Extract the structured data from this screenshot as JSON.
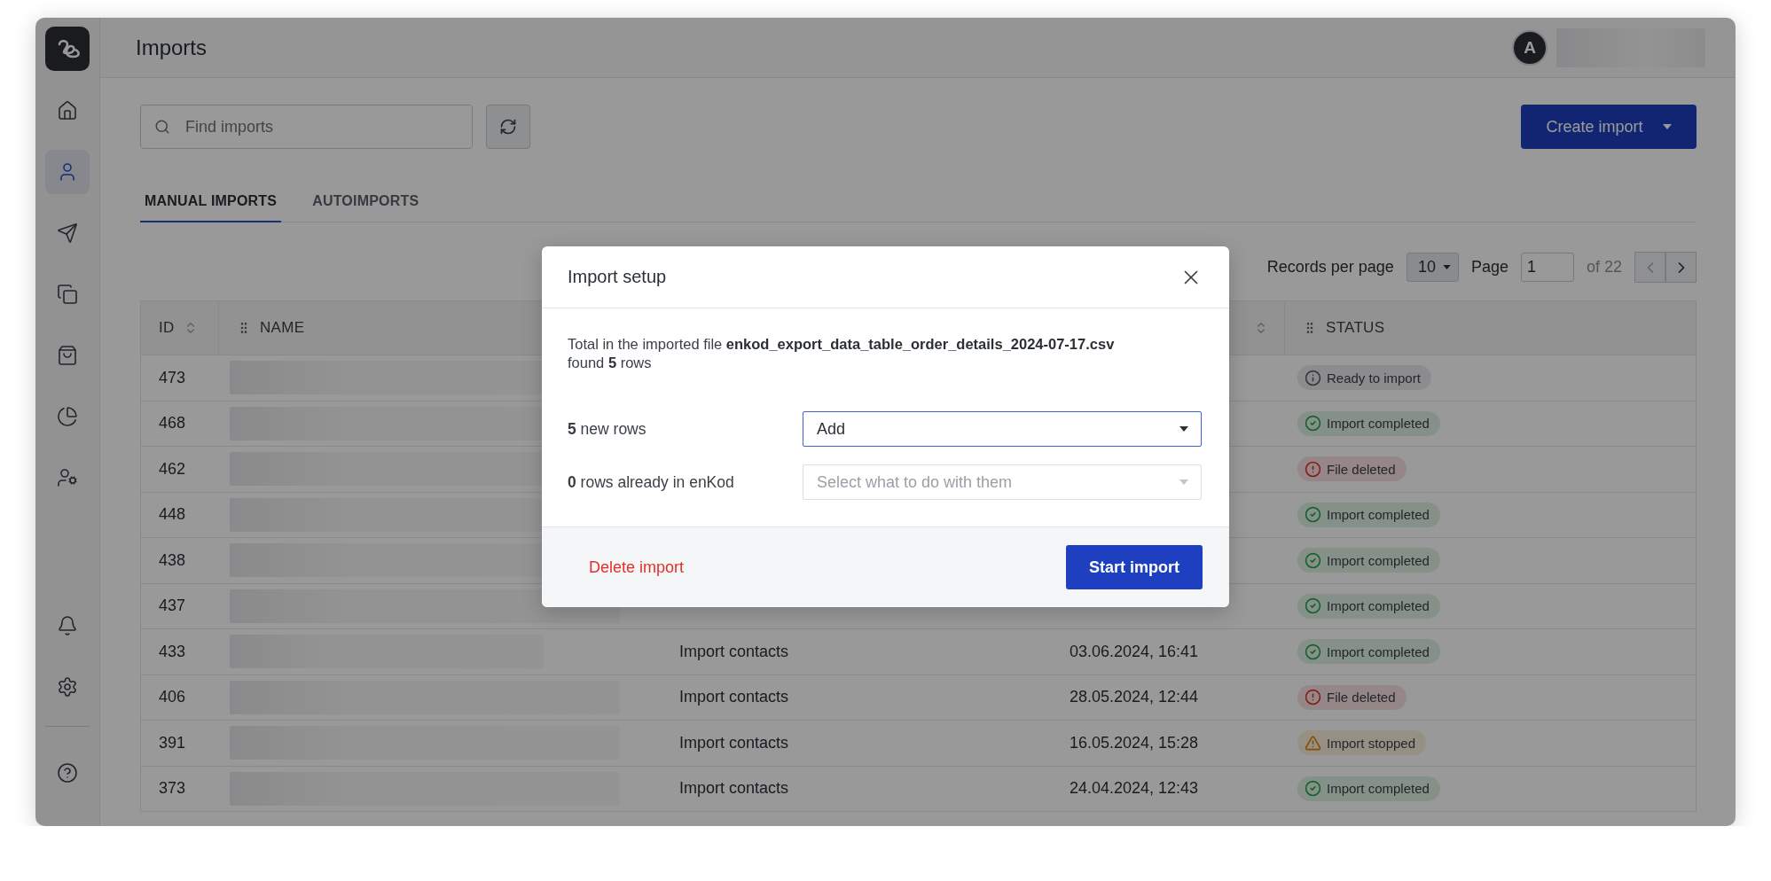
{
  "header": {
    "title": "Imports",
    "avatar": "A"
  },
  "sidebar": {
    "top_items": [
      {
        "selected": false
      },
      {
        "selected": true
      },
      {
        "selected": false
      },
      {
        "selected": false
      },
      {
        "selected": false
      },
      {
        "selected": false
      },
      {
        "selected": false
      }
    ],
    "bottom_items": [
      {
        "selected": false
      },
      {
        "selected": false
      },
      {
        "selected": false
      }
    ]
  },
  "toolbar": {
    "search": {
      "placeholder": "Find imports"
    },
    "create_button": "Create import"
  },
  "tabs": [
    {
      "label": "MANUAL IMPORTS",
      "selected": true
    },
    {
      "label": "AUTOIMPORTS",
      "selected": false
    }
  ],
  "pagination": {
    "records_label": "Records per page",
    "per_page": "10",
    "page_label": "Page",
    "page": "1",
    "total": "of 22",
    "prev_disabled": true
  },
  "table": {
    "columns": [
      {
        "label": "ID",
        "kind": "sort"
      },
      {
        "label": "NAME",
        "kind": "drag"
      },
      {
        "label": "STATUS",
        "kind": "drag"
      }
    ],
    "rows": [
      {
        "id": "473",
        "status": {
          "label": "Ready to import",
          "kind": "ready"
        }
      },
      {
        "id": "468",
        "status": {
          "label": "Import completed",
          "kind": "completed"
        }
      },
      {
        "id": "462",
        "status": {
          "label": "File deleted",
          "kind": "deleted"
        }
      },
      {
        "id": "448",
        "status": {
          "label": "Import completed",
          "kind": "completed"
        }
      },
      {
        "id": "438",
        "status": {
          "label": "Import completed",
          "kind": "completed"
        }
      },
      {
        "id": "437",
        "status": {
          "label": "Import completed",
          "kind": "completed"
        }
      },
      {
        "id": "433",
        "column_3": "Import contacts",
        "column_4": "03.06.2024, 16:41",
        "status": {
          "label": "Import completed",
          "kind": "completed"
        }
      },
      {
        "id": "406",
        "column_3": "Import contacts",
        "column_4": "28.05.2024, 12:44",
        "status": {
          "label": "File deleted",
          "kind": "deleted"
        }
      },
      {
        "id": "391",
        "column_3": "Import contacts",
        "column_4": "16.05.2024, 15:28",
        "status": {
          "label": "Import stopped",
          "kind": "stopped"
        }
      },
      {
        "id": "373",
        "column_3": "Import contacts",
        "column_4": "24.04.2024, 12:43",
        "status": {
          "label": "Import completed",
          "kind": "completed"
        }
      }
    ]
  },
  "modal": {
    "title": "Import setup",
    "text": "Total in the imported file **enkod_export_data_table_order_details_2024-07-17.csv** found **5** rows",
    "fields": [
      {
        "label": "**5** new rows",
        "value": "Add",
        "focused": true,
        "disabled": false
      },
      {
        "label": "**0** rows already in enKod",
        "placeholder": "Select what to do with them",
        "focused": false,
        "disabled": true
      }
    ],
    "delete_button": "Delete import",
    "start_button": "Start import"
  }
}
